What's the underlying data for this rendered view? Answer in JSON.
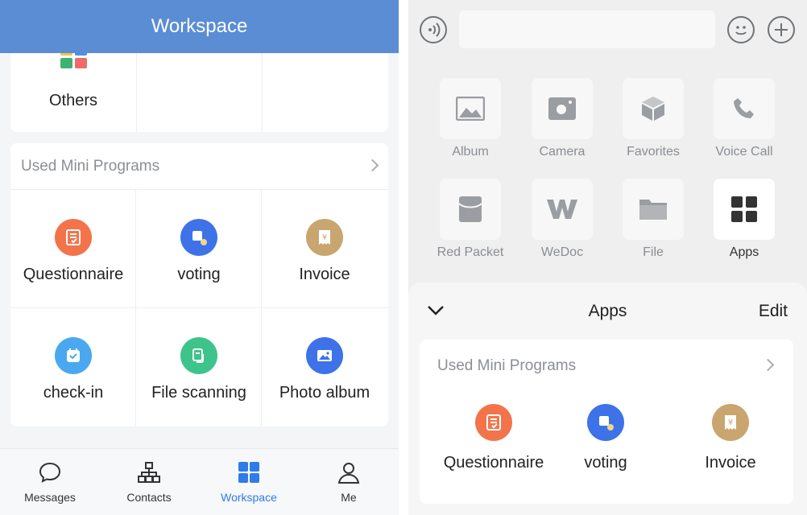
{
  "left": {
    "header_title": "Workspace",
    "others_label": "Others",
    "mini_programs": {
      "title": "Used Mini Programs",
      "items": [
        {
          "label": "Questionnaire",
          "icon": "questionnaire-icon",
          "color": "#f3744b"
        },
        {
          "label": "voting",
          "icon": "voting-icon",
          "color": "#3e72e8"
        },
        {
          "label": "Invoice",
          "icon": "invoice-icon",
          "color": "#c9a56f"
        },
        {
          "label": "check-in",
          "icon": "check-in-icon",
          "color": "#4aa8f0"
        },
        {
          "label": "File scanning",
          "icon": "file-scanning-icon",
          "color": "#3ec48a"
        },
        {
          "label": "Photo album",
          "icon": "photo-album-icon",
          "color": "#3e72e8"
        }
      ]
    },
    "tabs": [
      {
        "label": "Messages",
        "icon": "chat-bubble-icon",
        "active": false
      },
      {
        "label": "Contacts",
        "icon": "org-chart-icon",
        "active": false
      },
      {
        "label": "Workspace",
        "icon": "grid-icon",
        "active": true
      },
      {
        "label": "Me",
        "icon": "person-icon",
        "active": false
      }
    ]
  },
  "right": {
    "input_value": "",
    "tools": [
      {
        "label": "Album",
        "icon": "image-icon"
      },
      {
        "label": "Camera",
        "icon": "camera-icon"
      },
      {
        "label": "Favorites",
        "icon": "cube-icon"
      },
      {
        "label": "Voice Call",
        "icon": "phone-icon"
      },
      {
        "label": "Red Packet",
        "icon": "envelope-icon"
      },
      {
        "label": "WeDoc",
        "icon": "wedoc-icon"
      },
      {
        "label": "File",
        "icon": "folder-icon"
      },
      {
        "label": "Apps",
        "icon": "grid-icon"
      }
    ],
    "sheet": {
      "title": "Apps",
      "edit_label": "Edit",
      "mini_title": "Used Mini Programs",
      "items": [
        {
          "label": "Questionnaire",
          "icon": "questionnaire-icon"
        },
        {
          "label": "voting",
          "icon": "voting-icon"
        },
        {
          "label": "Invoice",
          "icon": "invoice-icon"
        }
      ]
    }
  },
  "colors": {
    "header_blue": "#5b8dd4",
    "active_tab": "#2f7bea"
  }
}
